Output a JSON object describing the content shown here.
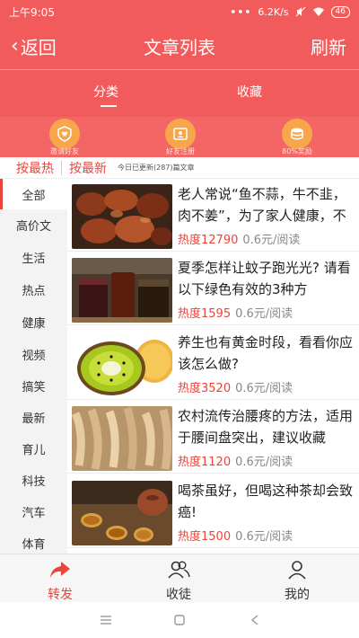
{
  "status_bar": {
    "time": "上午9:05",
    "dots": "•••",
    "speed": "6.2K/s",
    "battery": "46"
  },
  "header": {
    "back_label": "返回",
    "title": "文章列表",
    "refresh_label": "刷新"
  },
  "tabs": [
    {
      "label": "分类",
      "active": true
    },
    {
      "label": "收藏",
      "active": false
    }
  ],
  "quick_icons": [
    {
      "label": "邀请好友",
      "icon": "heart-shield-icon"
    },
    {
      "label": "好友注册",
      "icon": "id-card-icon"
    },
    {
      "label": "80%奖励",
      "icon": "coins-icon"
    }
  ],
  "sort_bar": {
    "hot_label": "按最热",
    "new_label": "按最新",
    "info": "今日已更新(287)篇文章"
  },
  "categories": [
    "全部",
    "高价文",
    "生活",
    "热点",
    "健康",
    "视频",
    "搞笑",
    "最新",
    "育儿",
    "科技",
    "汽车",
    "体育"
  ],
  "articles": [
    {
      "title": "老人常说“鱼不蒜，牛不韭，肉不姜”，为了家人健康，不",
      "heat": "热度12790",
      "price": "0.6元/阅读",
      "thumb": "braised-meat-photo"
    },
    {
      "title": "夏季怎样让蚊子跑光光? 请看以下绿色有效的3种方",
      "heat": "热度1595",
      "price": "0.6元/阅读",
      "thumb": "herbal-drinks-photo"
    },
    {
      "title": "养生也有黄金时段，看看你应该怎么做?",
      "heat": "热度3520",
      "price": "0.6元/阅读",
      "thumb": "kiwi-fruit-photo"
    },
    {
      "title": "农村流传治腰疼的方法，适用于腰间盘突出，建议收藏",
      "heat": "热度1120",
      "price": "0.6元/阅读",
      "thumb": "dried-herbs-photo"
    },
    {
      "title": "喝茶虽好，但喝这种茶却会致癌!",
      "heat": "热度1500",
      "price": "0.6元/阅读",
      "thumb": "tea-set-photo"
    }
  ],
  "bottom_nav": [
    {
      "label": "转发",
      "icon": "share-arrow-icon",
      "active": true
    },
    {
      "label": "收徒",
      "icon": "people-icon",
      "active": false
    },
    {
      "label": "我的",
      "icon": "person-icon",
      "active": false
    }
  ],
  "colors": {
    "brand": "#f25b5b",
    "accent": "#e8453c",
    "icon_bg": "#f7a64b"
  }
}
